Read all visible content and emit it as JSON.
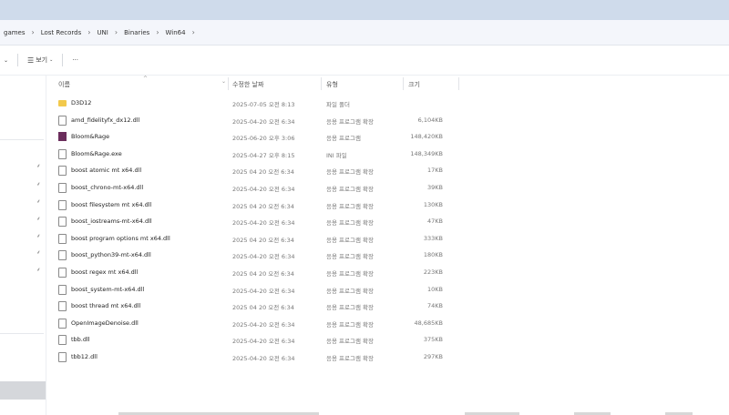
{
  "breadcrumb": [
    "games",
    "Lost Records",
    "UNI",
    "Binaries",
    "Win64"
  ],
  "breadcrumb_more": "›",
  "toolbar": {
    "view_label": "보기",
    "more_label": "···"
  },
  "columns": {
    "name": "이름",
    "date": "수정한 날짜",
    "type": "유형",
    "size": "크기"
  },
  "files": [
    {
      "icon": "folder",
      "name": "D3D12",
      "date": "2025-07-05 오전 8:13",
      "type": "파일 폴더",
      "size": ""
    },
    {
      "icon": "file",
      "name": "amd_fidelityfx_dx12.dll",
      "date": "2025-04-20 오전 6:34",
      "type": "응용 프로그램 확장",
      "size": "6,104KB"
    },
    {
      "icon": "exe",
      "name": "Bloom&Rage",
      "date": "2025-06-20 오후 3:06",
      "type": "응용 프로그램",
      "size": "148,420KB"
    },
    {
      "icon": "file",
      "name": "Bloom&Rage.exe",
      "date": "2025-04-27 오후 8:15",
      "type": "INI 파일",
      "size": "148,349KB"
    },
    {
      "icon": "file",
      "name": "boost atomic mt x64.dll",
      "date": "2025 04 20 오전 6:34",
      "type": "응용 프로그램 확장",
      "size": "17KB"
    },
    {
      "icon": "file",
      "name": "boost_chrono-mt-x64.dll",
      "date": "2025-04-20 오전 6:34",
      "type": "응용 프로그램 확장",
      "size": "39KB"
    },
    {
      "icon": "file",
      "name": "boost filesystem mt x64.dll",
      "date": "2025 04 20 오전 6:34",
      "type": "응용 프로그램 확장",
      "size": "130KB"
    },
    {
      "icon": "file",
      "name": "boost_iostreams-mt-x64.dll",
      "date": "2025-04-20 오전 6:34",
      "type": "응용 프로그램 확장",
      "size": "47KB"
    },
    {
      "icon": "file",
      "name": "boost program options mt x64.dll",
      "date": "2025 04 20 오전 6:34",
      "type": "응용 프로그램 확장",
      "size": "333KB"
    },
    {
      "icon": "file",
      "name": "boost_python39-mt-x64.dll",
      "date": "2025-04-20 오전 6:34",
      "type": "응용 프로그램 확장",
      "size": "180KB"
    },
    {
      "icon": "file",
      "name": "boost regex mt x64.dll",
      "date": "2025 04 20 오전 6:34",
      "type": "응용 프로그램 확장",
      "size": "223KB"
    },
    {
      "icon": "file",
      "name": "boost_system-mt-x64.dll",
      "date": "2025-04-20 오전 6:34",
      "type": "응용 프로그램 확장",
      "size": "10KB"
    },
    {
      "icon": "file",
      "name": "boost thread mt x64.dll",
      "date": "2025 04 20 오전 6:34",
      "type": "응용 프로그램 확장",
      "size": "74KB"
    },
    {
      "icon": "file",
      "name": "OpenImageDenoise.dll",
      "date": "2025-04-20 오전 6:34",
      "type": "응용 프로그램 확장",
      "size": "48,685KB"
    },
    {
      "icon": "file",
      "name": "tbb.dll",
      "date": "2025-04-20 오전 6:34",
      "type": "응용 프로그램 확장",
      "size": "375KB"
    },
    {
      "icon": "file",
      "name": "tbb12.dll",
      "date": "2025-04-20 오전 6:34",
      "type": "응용 프로그램 확장",
      "size": "297KB"
    }
  ]
}
